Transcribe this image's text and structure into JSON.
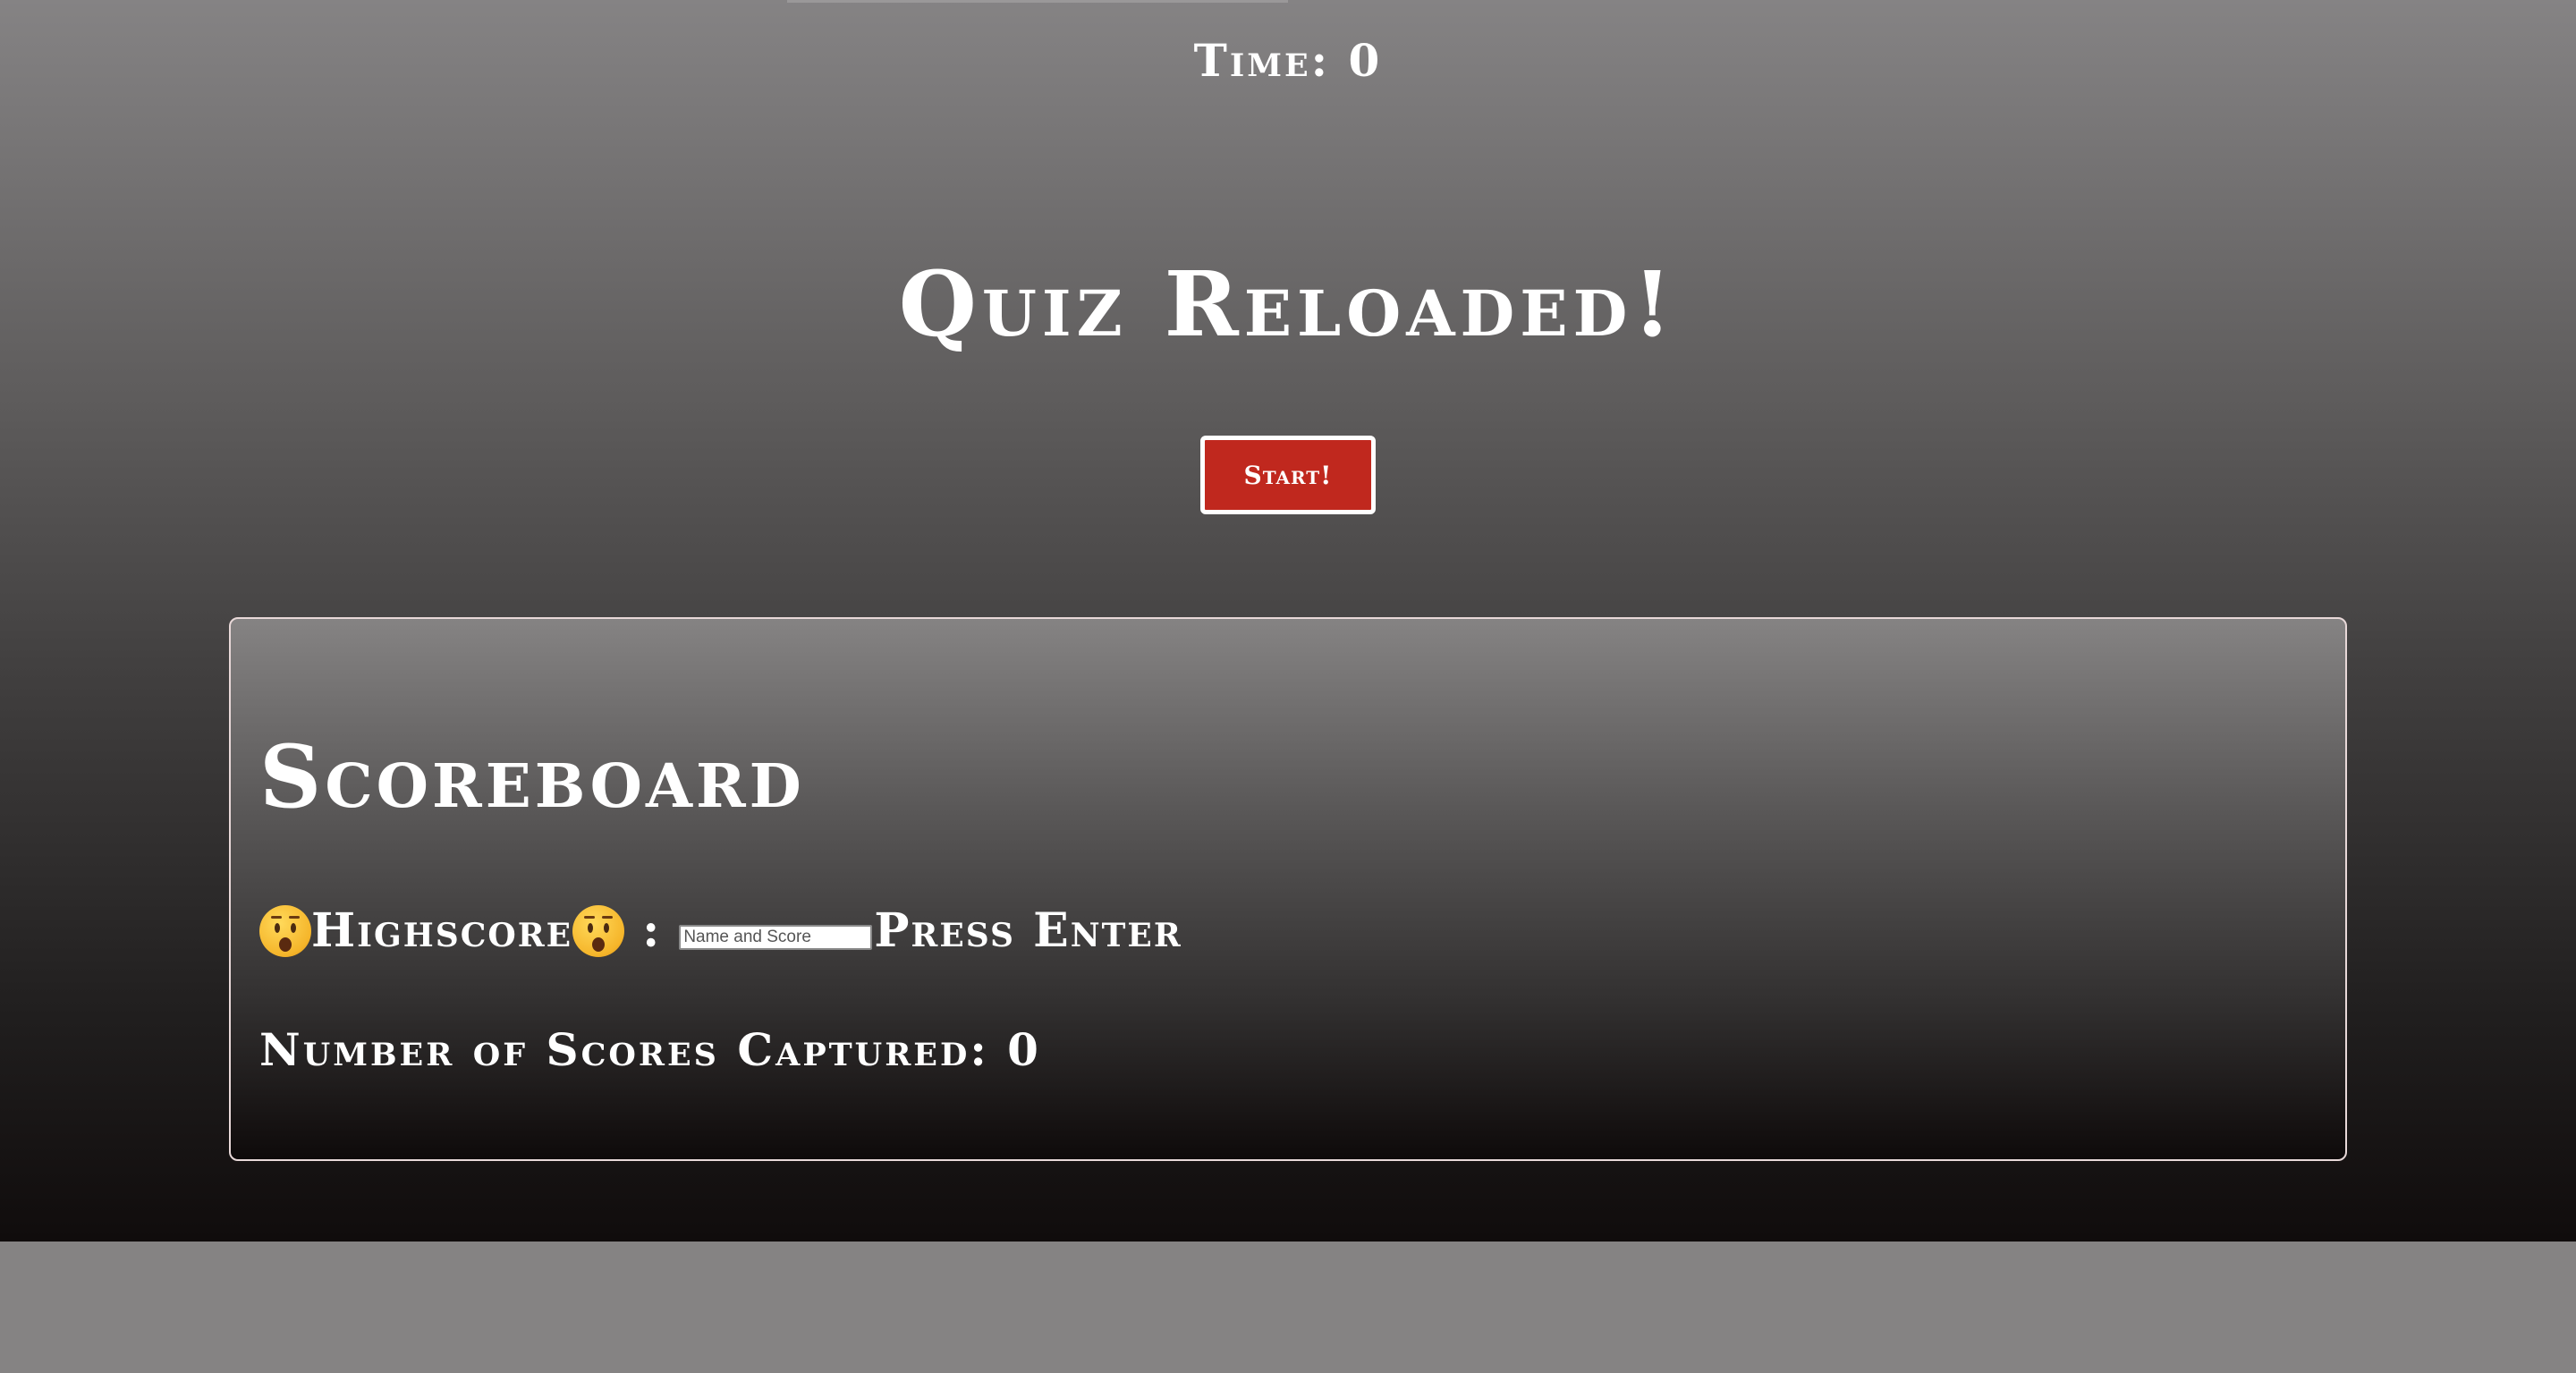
{
  "header": {
    "timer_text": "Time: 0"
  },
  "main": {
    "title": "Quiz Reloaded!",
    "start_button_label": "Start!"
  },
  "scoreboard": {
    "title": "Scoreboard",
    "highscore_label": "Highscore",
    "highscore_emoji": "astonished-face-icon",
    "colon": ":",
    "input_placeholder": "Name and Score",
    "input_value": "",
    "press_enter_text": "Press Enter",
    "count_text": "Number of Scores Captured: 0"
  },
  "colors": {
    "accent_button": "#c0281e",
    "text": "#ffffff",
    "page_background": "#858383"
  }
}
